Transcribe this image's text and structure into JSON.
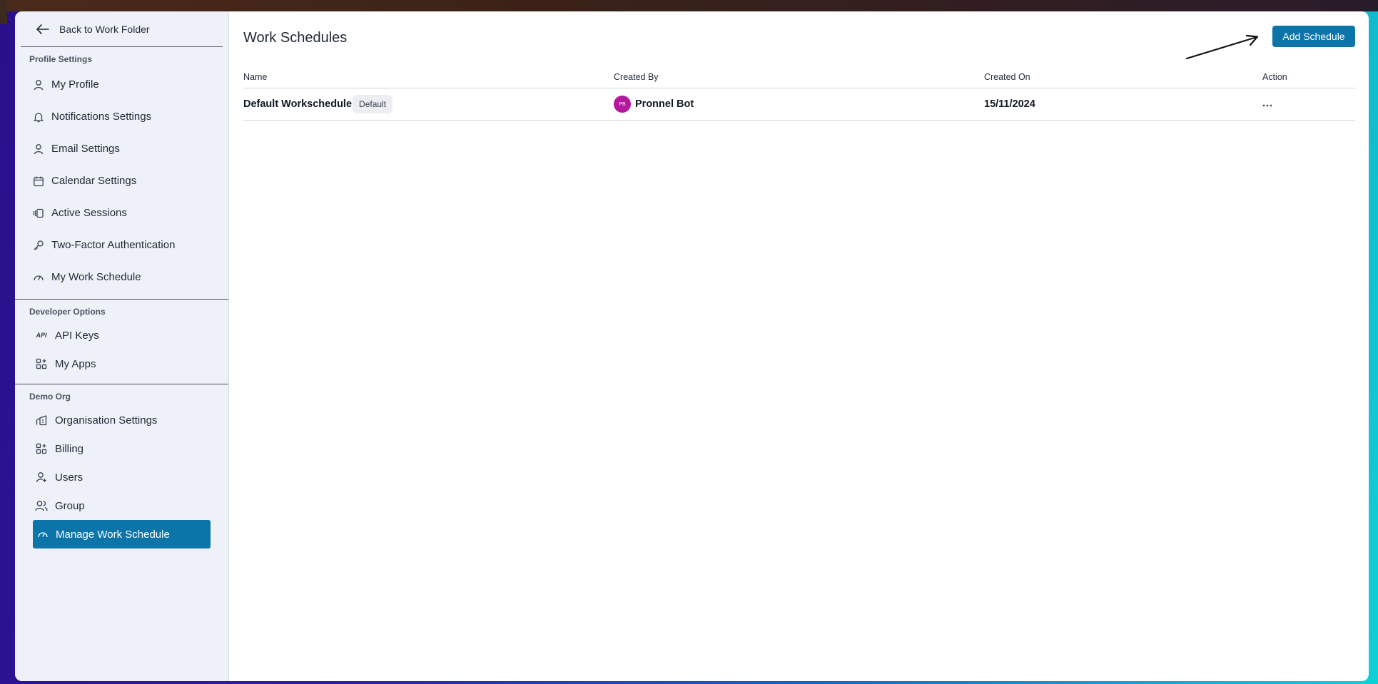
{
  "sidebar": {
    "back_label": "Back to Work Folder",
    "profile_title": "Profile Settings",
    "profile_items": [
      {
        "label": "My Profile",
        "icon": "user-icon"
      },
      {
        "label": "Notifications Settings",
        "icon": "bell-icon"
      },
      {
        "label": "Email Settings",
        "icon": "user-icon"
      },
      {
        "label": "Calendar Settings",
        "icon": "calendar-icon"
      },
      {
        "label": "Active Sessions",
        "icon": "sessions-icon"
      },
      {
        "label": "Two-Factor Authentication",
        "icon": "key-icon"
      },
      {
        "label": "My Work Schedule",
        "icon": "gauge-icon"
      }
    ],
    "developer_title": "Developer Options",
    "developer_items": [
      {
        "label": "API Keys",
        "icon": "api-icon",
        "icon_text": "API"
      },
      {
        "label": "My Apps",
        "icon": "apps-icon"
      }
    ],
    "org_title": "Demo Org",
    "org_items": [
      {
        "label": "Organisation Settings",
        "icon": "building-icon"
      },
      {
        "label": "Billing",
        "icon": "apps-icon"
      },
      {
        "label": "Users",
        "icon": "user-plus-icon"
      },
      {
        "label": "Group",
        "icon": "users-icon"
      },
      {
        "label": "Manage Work Schedule",
        "icon": "gauge-icon",
        "active": true
      }
    ]
  },
  "main": {
    "title": "Work Schedules",
    "add_button_label": "Add Schedule",
    "columns": [
      "Name",
      "Created By",
      "Created On",
      "Action"
    ],
    "rows": [
      {
        "name": "Default Workschedule",
        "badge": "Default",
        "creator_initials": "PB",
        "creator": "Pronnel Bot",
        "created_on": "15/11/2024",
        "action_icon": "more-horizontal-icon"
      }
    ]
  },
  "colors": {
    "accent": "#0b74a8",
    "avatar": "#b5179e",
    "sidebar_bg": "#eff1f8"
  }
}
